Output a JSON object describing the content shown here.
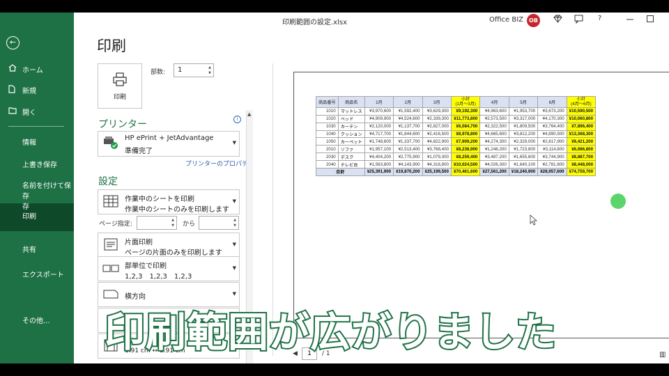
{
  "window": {
    "title": "印刷範囲の設定.xlsx",
    "account_name": "Office BIZ",
    "avatar_initials": "OB",
    "icons": [
      "diamond-icon",
      "comment-icon",
      "help-icon",
      "minimize-icon",
      "restore-icon"
    ],
    "help_label": "?"
  },
  "nav": {
    "back_glyph": "←",
    "items": [
      {
        "label": "ホーム",
        "icon": "home-icon"
      },
      {
        "label": "新規",
        "icon": "new-file-icon"
      },
      {
        "label": "開く",
        "icon": "folder-open-icon"
      },
      {
        "label": "情報"
      },
      {
        "label": "上書き保存"
      },
      {
        "label": "名前を付けて保存"
      },
      {
        "label": "存"
      },
      {
        "label": "印刷"
      },
      {
        "label": "共有"
      },
      {
        "label": "エクスポート"
      },
      {
        "label": "その他..."
      }
    ],
    "active": "印刷",
    "accent_color": "#1e7145"
  },
  "print": {
    "title": "印刷",
    "button_label": "印刷",
    "copies_label": "部数:",
    "copies_value": "1"
  },
  "printer": {
    "section_title": "プリンター",
    "name": "HP ePrint + JetAdvantage",
    "status": "準備完了",
    "properties_link": "プリンターのプロパティ",
    "info_glyph": "i"
  },
  "settings": {
    "section_title": "設定",
    "what_to_print": {
      "title": "作業中のシートを印刷",
      "subtitle": "作業中のシートのみを印刷します"
    },
    "pages_label": "ページ指定:",
    "pages_to_label": "から",
    "sides": {
      "title": "片面印刷",
      "subtitle": "ページの片面のみを印刷します"
    },
    "collate": {
      "title": "部単位で印刷",
      "subtitle": "1,2,3　1,2,3　1,2,3"
    },
    "orientation": {
      "title": "横方向"
    },
    "margins_partial": "1.91 cm ↔ 1.91 cm"
  },
  "preview": {
    "page_current": "1",
    "page_total": "/ 1",
    "table": {
      "headers": [
        "商品番号",
        "商品名",
        "1月",
        "2月",
        "3月",
        "小計\n(1月～3月)",
        "4月",
        "5月",
        "6月",
        "小計\n(4月～6月)"
      ],
      "rows": [
        [
          "1010",
          "マットレス",
          "¥3,970,600",
          "¥1,592,400",
          "¥3,629,300",
          "¥9,192,300",
          "¥4,963,600",
          "¥1,953,700",
          "¥3,673,200",
          "¥10,590,500"
        ],
        [
          "1020",
          "ベッド",
          "¥4,909,900",
          "¥4,524,600",
          "¥2,339,300",
          "¥11,773,800",
          "¥2,573,500",
          "¥3,317,000",
          "¥4,170,300",
          "¥10,060,800"
        ],
        [
          "1030",
          "カーテン",
          "¥2,120,000",
          "¥1,137,700",
          "¥2,827,000",
          "¥6,084,700",
          "¥2,322,500",
          "¥1,809,500",
          "¥3,764,400",
          "¥7,896,400"
        ],
        [
          "1040",
          "クッション",
          "¥4,717,700",
          "¥1,844,600",
          "¥2,416,500",
          "¥8,978,800",
          "¥4,665,600",
          "¥3,812,200",
          "¥4,890,500",
          "¥13,368,300"
        ],
        [
          "1050",
          "カーペット",
          "¥1,748,600",
          "¥1,337,700",
          "¥4,822,900",
          "¥7,909,200",
          "¥4,274,300",
          "¥2,329,000",
          "¥2,817,900",
          "¥9,421,200"
        ],
        [
          "2010",
          "ソファ",
          "¥1,957,100",
          "¥2,513,400",
          "¥3,768,400",
          "¥8,238,900",
          "¥1,248,200",
          "¥1,723,800",
          "¥3,114,800",
          "¥6,086,800"
        ],
        [
          "2030",
          "デスク",
          "¥4,404,200",
          "¥2,775,900",
          "¥1,079,300",
          "¥8,259,400",
          "¥3,487,200",
          "¥1,655,600",
          "¥3,744,900",
          "¥8,887,700"
        ],
        [
          "2040",
          "テレビ台",
          "¥1,563,800",
          "¥4,143,900",
          "¥4,316,800",
          "¥10,024,500",
          "¥4,026,300",
          "¥1,640,100",
          "¥2,781,600",
          "¥8,448,000"
        ]
      ],
      "total": [
        "合計",
        "¥25,391,900",
        "¥19,870,200",
        "¥25,199,500",
        "¥70,461,600",
        "¥27,561,200",
        "¥18,240,900",
        "¥28,957,600",
        "¥74,759,700"
      ],
      "header_color": "#d9e1f2",
      "highlight_color": "#ffff00"
    }
  },
  "caption": "印刷範囲が広がりました"
}
